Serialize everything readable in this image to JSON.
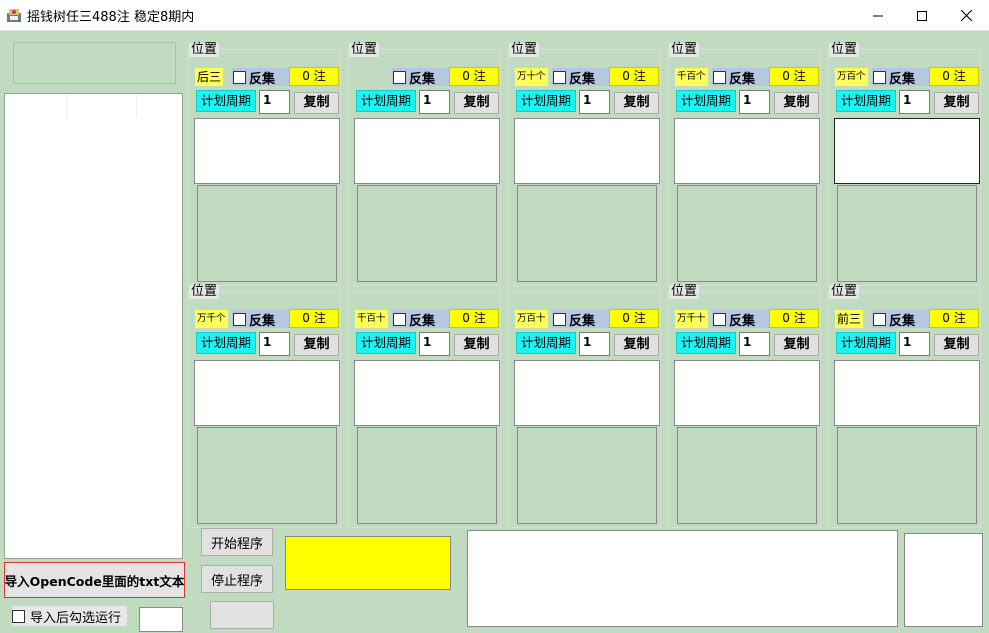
{
  "window": {
    "title": "摇钱树任三488注 稳定8期内"
  },
  "left_panel": {
    "import_button": "导入OpenCode里面的txt文本",
    "run_after_import_label": "导入后勾选运行"
  },
  "groups_row1": [
    {
      "legend": "位置",
      "selector": "后三",
      "invert": "反集",
      "count": "0 注",
      "plan": "计划周期",
      "period": "1",
      "copy": "复制"
    },
    {
      "legend": "位置",
      "selector": "",
      "invert": "反集",
      "count": "0 注",
      "plan": "计划周期",
      "period": "1",
      "copy": "复制"
    },
    {
      "legend": "位置",
      "selector": "万十个",
      "invert": "反集",
      "count": "0 注",
      "plan": "计划周期",
      "period": "1",
      "copy": "复制"
    },
    {
      "legend": "位置",
      "selector": "千百个",
      "invert": "反集",
      "count": "0 注",
      "plan": "计划周期",
      "period": "1",
      "copy": "复制"
    },
    {
      "legend": "位置",
      "selector": "万百个",
      "invert": "反集",
      "count": "0 注",
      "plan": "计划周期",
      "period": "1",
      "copy": "复制"
    }
  ],
  "groups_row2": [
    {
      "legend": "位置",
      "selector": "万千个",
      "invert": "反集",
      "count": "0 注",
      "plan": "计划周期",
      "period": "1",
      "copy": "复制"
    },
    {
      "legend": "",
      "selector": "千百十",
      "invert": "反集",
      "count": "0 注",
      "plan": "计划周期",
      "period": "1",
      "copy": "复制"
    },
    {
      "legend": "",
      "selector": "万百十",
      "invert": "反集",
      "count": "0 注",
      "plan": "计划周期",
      "period": "1",
      "copy": "复制"
    },
    {
      "legend": "位置",
      "selector": "万千十",
      "invert": "反集",
      "count": "0 注",
      "plan": "计划周期",
      "period": "1",
      "copy": "复制"
    },
    {
      "legend": "位置",
      "selector": "前三",
      "invert": "反集",
      "count": "0 注",
      "plan": "计划周期",
      "period": "1",
      "copy": "复制"
    }
  ],
  "controls": {
    "start": "开始程序",
    "stop": "停止程序"
  },
  "colors": {
    "background": "#c1dbc1",
    "count_yellow": "#ffff00",
    "plan_cyan": "#1cf4f4",
    "invert_blue": "#b4c8e4",
    "import_border": "#dd3333"
  }
}
